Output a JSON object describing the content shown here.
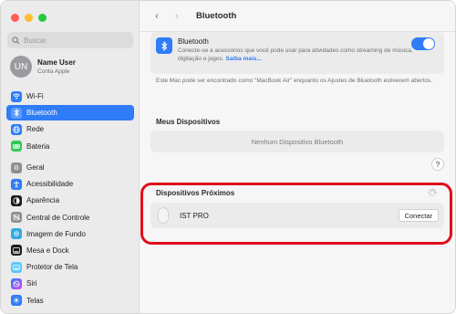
{
  "window": {
    "traffic": [
      "#fe5f57",
      "#febc2e",
      "#28c840"
    ]
  },
  "search": {
    "placeholder": "Buscar"
  },
  "user": {
    "initials": "UN",
    "name": "Name User",
    "subtitle": "Conta Apple"
  },
  "sidebar": {
    "group1": [
      {
        "label": "Wi-Fi",
        "icon": "wifi-icon",
        "color": "#2f7cf6"
      },
      {
        "label": "Bluetooth",
        "icon": "bluetooth-icon",
        "color": "#2f7cf6",
        "active": true
      },
      {
        "label": "Rede",
        "icon": "globe-icon",
        "color": "#2f7cf6"
      },
      {
        "label": "Bateria",
        "icon": "battery-icon",
        "color": "#34c759"
      }
    ],
    "group2": [
      {
        "label": "Geral",
        "icon": "gear-icon",
        "color": "#8e8e93"
      },
      {
        "label": "Acessibilidade",
        "icon": "accessibility-icon",
        "color": "#2f7cf6"
      },
      {
        "label": "Aparência",
        "icon": "appearance-icon",
        "color": "#1d1d1f"
      },
      {
        "label": "Central de Controle",
        "icon": "control-center-icon",
        "color": "#8e8e93"
      },
      {
        "label": "Imagem de Fundo",
        "icon": "wallpaper-icon",
        "color": "#35aadc"
      },
      {
        "label": "Mesa e Dock",
        "icon": "dock-icon",
        "color": "#1d1d1f"
      },
      {
        "label": "Protetor de Tela",
        "icon": "screensaver-icon",
        "color": "#5ac8fa"
      },
      {
        "label": "Siri",
        "icon": "siri-icon",
        "color": "#9b59b6"
      },
      {
        "label": "Telas",
        "icon": "displays-icon",
        "color": "#2f7cf6"
      }
    ]
  },
  "toolbar": {
    "back": "‹",
    "forward": "›",
    "title": "Bluetooth"
  },
  "bluetooth": {
    "title": "Bluetooth",
    "description": "Conecte-se a acessórios que você pode usar para atividades como streaming de música, digitação e jogos.",
    "learn_more": "Saiba mais...",
    "enabled": true,
    "note": "Este Mac pode ser encontrado como \"MacBook Air\" enquanto os Ajustes de Bluetooth estiverem abertos."
  },
  "my_devices": {
    "title": "Meus Dispositivos",
    "empty": "Nenhum Dispositivo Bluetooth"
  },
  "help": "?",
  "nearby": {
    "title": "Dispositivos Próximos",
    "device_name": "IST PRO",
    "connect_label": "Conectar"
  },
  "accent": "#2f7cf6",
  "highlight_color": "#e00d1c"
}
